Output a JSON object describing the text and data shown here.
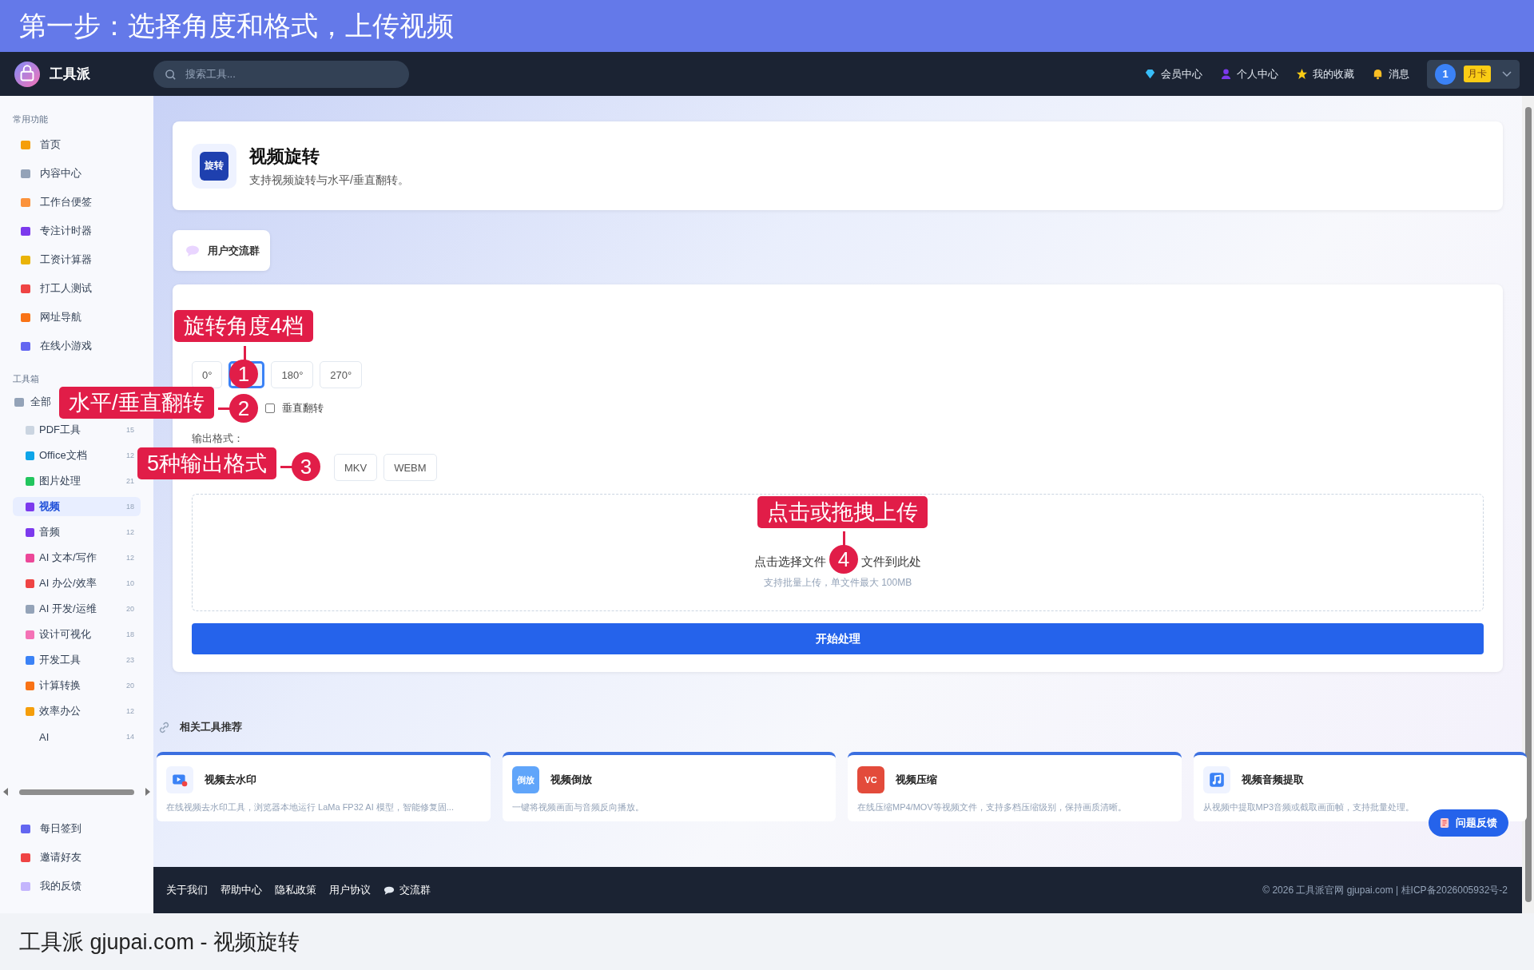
{
  "banner": {
    "title": "第一步：选择角度和格式，上传视频"
  },
  "navbar": {
    "brand": "工具派",
    "search": {
      "placeholder": "搜索工具..."
    },
    "links": [
      {
        "label": "会员中心",
        "kind": "diamond"
      },
      {
        "label": "个人中心",
        "kind": "person"
      },
      {
        "label": "我的收藏",
        "kind": "star"
      },
      {
        "label": "消息",
        "kind": "bell"
      }
    ],
    "user": {
      "avatar": "1",
      "badge": "月卡"
    }
  },
  "sidebar": {
    "sections": [
      {
        "title": "常用功能",
        "items": [
          {
            "label": "首页",
            "selected": false
          },
          {
            "label": "内容中心",
            "selected": false
          },
          {
            "label": "工作台便签",
            "selected": false
          },
          {
            "label": "专注计时器",
            "selected": false
          },
          {
            "label": "工资计算器",
            "selected": false
          },
          {
            "label": "打工人测试",
            "selected": false
          },
          {
            "label": "网址导航",
            "selected": false
          },
          {
            "label": "在线小游戏",
            "selected": false
          }
        ]
      },
      {
        "title": "工具箱",
        "items": [
          {
            "label": "全部",
            "selected": false,
            "children": [
              {
                "label": "PDF工具",
                "count": "15",
                "selected": false
              },
              {
                "label": "Office文档",
                "count": "12",
                "selected": false
              },
              {
                "label": "图片处理",
                "count": "21",
                "selected": false
              },
              {
                "label": "视频",
                "count": "18",
                "selected": true
              },
              {
                "label": "音频",
                "count": "12",
                "selected": false
              },
              {
                "label": "AI 文本/写作",
                "count": "12",
                "selected": false
              },
              {
                "label": "AI 办公/效率",
                "count": "10",
                "selected": false
              },
              {
                "label": "AI 开发/运维",
                "count": "20",
                "selected": false
              },
              {
                "label": "设计可视化",
                "count": "18",
                "selected": false
              },
              {
                "label": "开发工具",
                "count": "23",
                "selected": false
              },
              {
                "label": "计算转换",
                "count": "20",
                "selected": false
              },
              {
                "label": "效率办公",
                "count": "12",
                "selected": false
              },
              {
                "label": "AI",
                "count": "14",
                "selected": false
              }
            ]
          }
        ]
      }
    ],
    "footer_items": [
      {
        "label": "每日签到"
      },
      {
        "label": "邀请好友"
      },
      {
        "label": "我的反馈"
      }
    ]
  },
  "tool": {
    "icon_text": "旋转",
    "title": "视频旋转",
    "description": "支持视频旋转与水平/垂直翻转。"
  },
  "chat_button": {
    "label": "用户交流群"
  },
  "form": {
    "angles": [
      {
        "label": "0°",
        "selected": false
      },
      {
        "selected": true
      },
      {
        "label": "180°",
        "selected": false
      },
      {
        "label": "270°",
        "selected": false
      }
    ],
    "vertical_flip": {
      "label": "垂直翻转",
      "checked": false
    },
    "format_label": "输出格式：",
    "formats": [
      {
        "label": "MKV",
        "selected": false
      },
      {
        "label": "WEBM",
        "selected": false
      }
    ],
    "upload": {
      "text_start": "点击选择文件",
      "text_end": "文件到此处",
      "hint": "支持批量上传，单文件最大 100MB"
    },
    "submit": "开始处理"
  },
  "related": {
    "title": "相关工具推荐",
    "cards": [
      {
        "title": "视频去水印",
        "description": "在线视频去水印工具，浏览器本地运行 LaMa FP32 AI 模型，智能修复固...",
        "icon": {
          "kind": "video"
        }
      },
      {
        "title": "视频倒放",
        "description": "一键将视频画面与音频反向播放。",
        "icon": {
          "kind": "text",
          "text": "倒放"
        }
      },
      {
        "title": "视频压缩",
        "description": "在线压缩MP4/MOV等视频文件，支持多档压缩级别，保持画质清晰。",
        "icon": {
          "kind": "text",
          "text": "VC"
        }
      },
      {
        "title": "视频音频提取",
        "description": "从视频中提取MP3音频或截取画面帧，支持批量处理。",
        "icon": {
          "kind": "music"
        }
      }
    ]
  },
  "feedback_button": {
    "label": "问题反馈"
  },
  "footer": {
    "links": [
      {
        "label": "关于我们",
        "kind": "text"
      },
      {
        "label": "帮助中心",
        "kind": "text"
      },
      {
        "label": "隐私政策",
        "kind": "text"
      },
      {
        "label": "用户协议",
        "kind": "text"
      },
      {
        "label": "交流群",
        "kind": "chat"
      }
    ],
    "copyright": "© 2026 工具派官网 gjupai.com | 桂ICP备2026005932号-2"
  },
  "caption": "工具派 gjupai.com - 视频旋转",
  "annotations": [
    {
      "number": "1",
      "label": "旋转角度4档"
    },
    {
      "number": "2",
      "label": "水平/垂直翻转"
    },
    {
      "number": "3",
      "label": "5种输出格式"
    },
    {
      "number": "4",
      "label": "点击或拖拽上传"
    }
  ]
}
